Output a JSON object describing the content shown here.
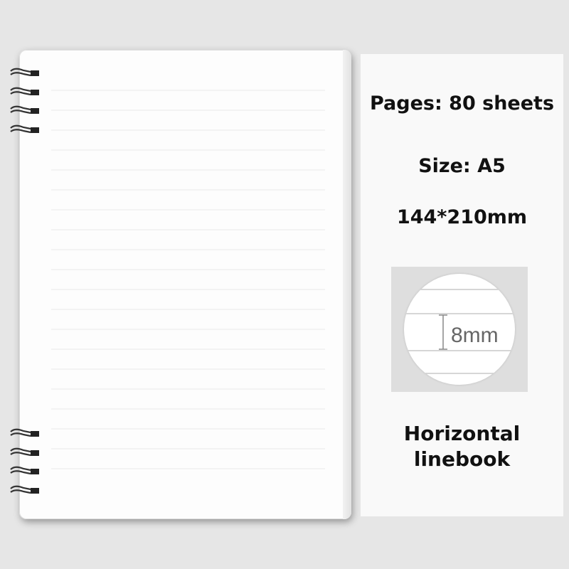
{
  "product": {
    "specs": {
      "pages": "Pages: 80 sheets",
      "size": "Size: A5",
      "dimensions": "144*210mm",
      "line_spacing": "8mm",
      "type_line1": "Horizontal",
      "type_line2": "linebook"
    },
    "colors": {
      "background": "#e6e6e6",
      "paper": "#fdfdfd",
      "rule": "#e9e9e9",
      "ring": "#333333",
      "panel": "#f9f9f9"
    },
    "icons": [
      "spiral-ring-icon",
      "dimension-marker-icon"
    ]
  }
}
